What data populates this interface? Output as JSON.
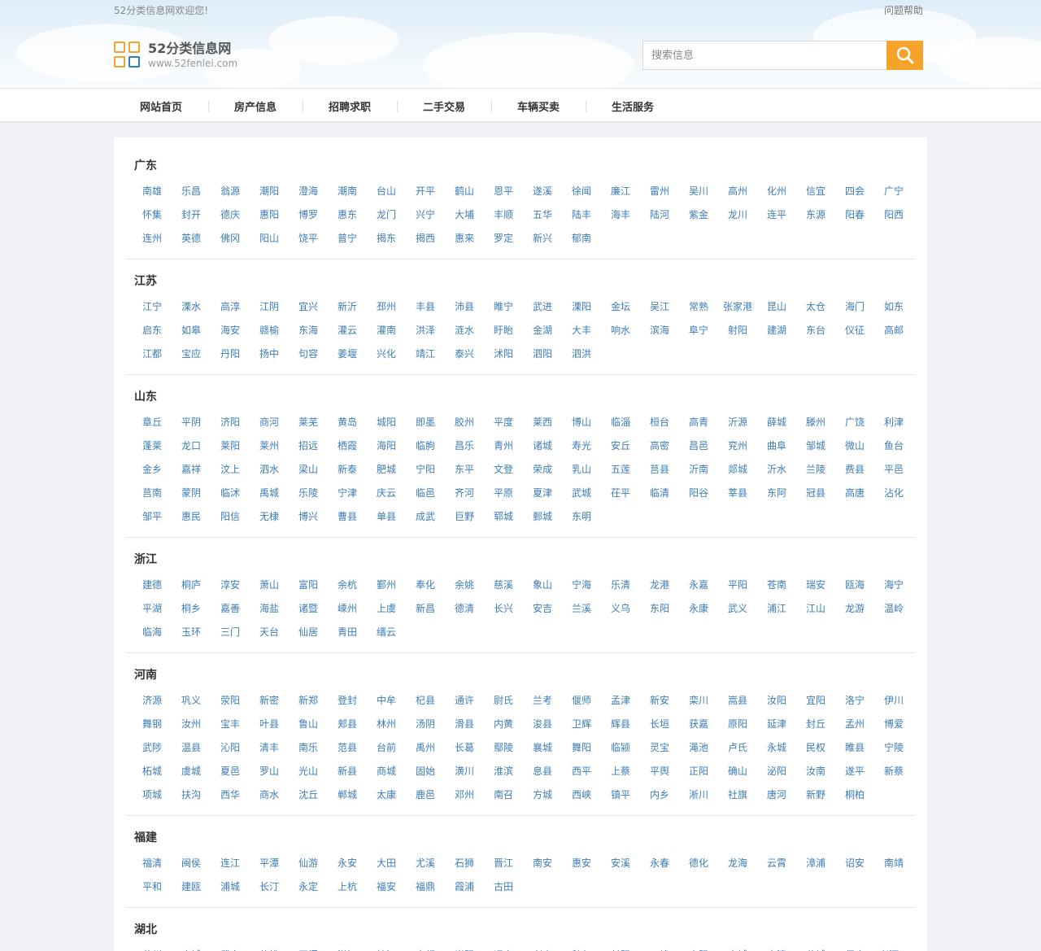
{
  "topbar": {
    "welcome": "52分类信息网欢迎您!",
    "help": "问题帮助"
  },
  "logo": {
    "name": "52分类信息网",
    "url": "www.52fenlei.com"
  },
  "search": {
    "placeholder": "搜索信息",
    "icon": "search-icon"
  },
  "nav": [
    "网站首页",
    "房产信息",
    "招聘求职",
    "二手交易",
    "车辆买卖",
    "生活服务"
  ],
  "provinces": [
    {
      "name": "广东",
      "cities": [
        "南雄",
        "乐昌",
        "翁源",
        "潮阳",
        "澄海",
        "潮南",
        "台山",
        "开平",
        "鹤山",
        "恩平",
        "遂溪",
        "徐闻",
        "廉江",
        "雷州",
        "吴川",
        "高州",
        "化州",
        "信宜",
        "四会",
        "广宁",
        "怀集",
        "封开",
        "德庆",
        "惠阳",
        "博罗",
        "惠东",
        "龙门",
        "兴宁",
        "大埔",
        "丰顺",
        "五华",
        "陆丰",
        "海丰",
        "陆河",
        "紫金",
        "龙川",
        "连平",
        "东源",
        "阳春",
        "阳西",
        "连州",
        "英德",
        "佛冈",
        "阳山",
        "饶平",
        "普宁",
        "揭东",
        "揭西",
        "惠来",
        "罗定",
        "新兴",
        "郁南"
      ]
    },
    {
      "name": "江苏",
      "cities": [
        "江宁",
        "溧水",
        "高淳",
        "江阴",
        "宜兴",
        "新沂",
        "邳州",
        "丰县",
        "沛县",
        "睢宁",
        "武进",
        "溧阳",
        "金坛",
        "吴江",
        "常熟",
        "张家港",
        "昆山",
        "太仓",
        "海门",
        "如东",
        "启东",
        "如皋",
        "海安",
        "赣榆",
        "东海",
        "灌云",
        "灌南",
        "洪泽",
        "涟水",
        "盱眙",
        "金湖",
        "大丰",
        "响水",
        "滨海",
        "阜宁",
        "射阳",
        "建湖",
        "东台",
        "仪征",
        "高邮",
        "江都",
        "宝应",
        "丹阳",
        "扬中",
        "句容",
        "姜堰",
        "兴化",
        "靖江",
        "泰兴",
        "沭阳",
        "泗阳",
        "泗洪"
      ]
    },
    {
      "name": "山东",
      "cities": [
        "章丘",
        "平阴",
        "济阳",
        "商河",
        "莱芜",
        "黄岛",
        "城阳",
        "即墨",
        "胶州",
        "平度",
        "莱西",
        "博山",
        "临淄",
        "桓台",
        "高青",
        "沂源",
        "薛城",
        "滕州",
        "广饶",
        "利津",
        "蓬莱",
        "龙口",
        "莱阳",
        "莱州",
        "招远",
        "栖霞",
        "海阳",
        "临朐",
        "昌乐",
        "青州",
        "诸城",
        "寿光",
        "安丘",
        "高密",
        "昌邑",
        "兖州",
        "曲阜",
        "邹城",
        "微山",
        "鱼台",
        "金乡",
        "嘉祥",
        "汶上",
        "泗水",
        "梁山",
        "新泰",
        "肥城",
        "宁阳",
        "东平",
        "文登",
        "荣成",
        "乳山",
        "五莲",
        "莒县",
        "沂南",
        "郯城",
        "沂水",
        "兰陵",
        "费县",
        "平邑",
        "莒南",
        "蒙阴",
        "临沭",
        "禹城",
        "乐陵",
        "宁津",
        "庆云",
        "临邑",
        "齐河",
        "平原",
        "夏津",
        "武城",
        "茌平",
        "临清",
        "阳谷",
        "莘县",
        "东阿",
        "冠县",
        "高唐",
        "沾化",
        "邹平",
        "惠民",
        "阳信",
        "无棣",
        "博兴",
        "曹县",
        "单县",
        "成武",
        "巨野",
        "郓城",
        "鄄城",
        "东明"
      ]
    },
    {
      "name": "浙江",
      "cities": [
        "建德",
        "桐庐",
        "淳安",
        "萧山",
        "富阳",
        "余杭",
        "鄞州",
        "奉化",
        "余姚",
        "慈溪",
        "象山",
        "宁海",
        "乐清",
        "龙港",
        "永嘉",
        "平阳",
        "苍南",
        "瑞安",
        "瓯海",
        "海宁",
        "平湖",
        "桐乡",
        "嘉善",
        "海盐",
        "诸暨",
        "嵊州",
        "上虞",
        "新昌",
        "德清",
        "长兴",
        "安吉",
        "兰溪",
        "义乌",
        "东阳",
        "永康",
        "武义",
        "浦江",
        "江山",
        "龙游",
        "温岭",
        "临海",
        "玉环",
        "三门",
        "天台",
        "仙居",
        "青田",
        "缙云"
      ]
    },
    {
      "name": "河南",
      "cities": [
        "济源",
        "巩义",
        "荥阳",
        "新密",
        "新郑",
        "登封",
        "中牟",
        "杞县",
        "通许",
        "尉氏",
        "兰考",
        "偃师",
        "孟津",
        "新安",
        "栾川",
        "嵩县",
        "汝阳",
        "宜阳",
        "洛宁",
        "伊川",
        "舞钢",
        "汝州",
        "宝丰",
        "叶县",
        "鲁山",
        "郏县",
        "林州",
        "汤阴",
        "滑县",
        "内黄",
        "浚县",
        "卫辉",
        "辉县",
        "长垣",
        "获嘉",
        "原阳",
        "延津",
        "封丘",
        "孟州",
        "博爱",
        "武陟",
        "温县",
        "沁阳",
        "清丰",
        "南乐",
        "范县",
        "台前",
        "禹州",
        "长葛",
        "鄢陵",
        "襄城",
        "舞阳",
        "临颍",
        "灵宝",
        "渑池",
        "卢氏",
        "永城",
        "民权",
        "睢县",
        "宁陵",
        "柘城",
        "虞城",
        "夏邑",
        "罗山",
        "光山",
        "新县",
        "商城",
        "固始",
        "潢川",
        "淮滨",
        "息县",
        "西平",
        "上蔡",
        "平舆",
        "正阳",
        "确山",
        "泌阳",
        "汝南",
        "遂平",
        "新蔡",
        "项城",
        "扶沟",
        "西华",
        "商水",
        "沈丘",
        "郸城",
        "太康",
        "鹿邑",
        "邓州",
        "南召",
        "方城",
        "西峡",
        "镇平",
        "内乡",
        "淅川",
        "社旗",
        "唐河",
        "新野",
        "桐柏"
      ]
    },
    {
      "name": "福建",
      "cities": [
        "福清",
        "闽侯",
        "连江",
        "平潭",
        "仙游",
        "永安",
        "大田",
        "尤溪",
        "石狮",
        "晋江",
        "南安",
        "惠安",
        "安溪",
        "永春",
        "德化",
        "龙海",
        "云霄",
        "漳浦",
        "诏安",
        "南靖",
        "平和",
        "建瓯",
        "浦城",
        "长汀",
        "永定",
        "上杭",
        "福安",
        "福鼎",
        "霞浦",
        "古田"
      ]
    },
    {
      "name": "湖北",
      "cities": [
        "黄州",
        "麻城",
        "武穴",
        "仙桃",
        "天门",
        "潜江",
        "枝江",
        "宜都",
        "当阳",
        "远安",
        "兴山",
        "秭归",
        "长阳",
        "五峰",
        "枣阳",
        "宜城",
        "南漳",
        "谷城",
        "保康",
        "老河口"
      ]
    }
  ]
}
